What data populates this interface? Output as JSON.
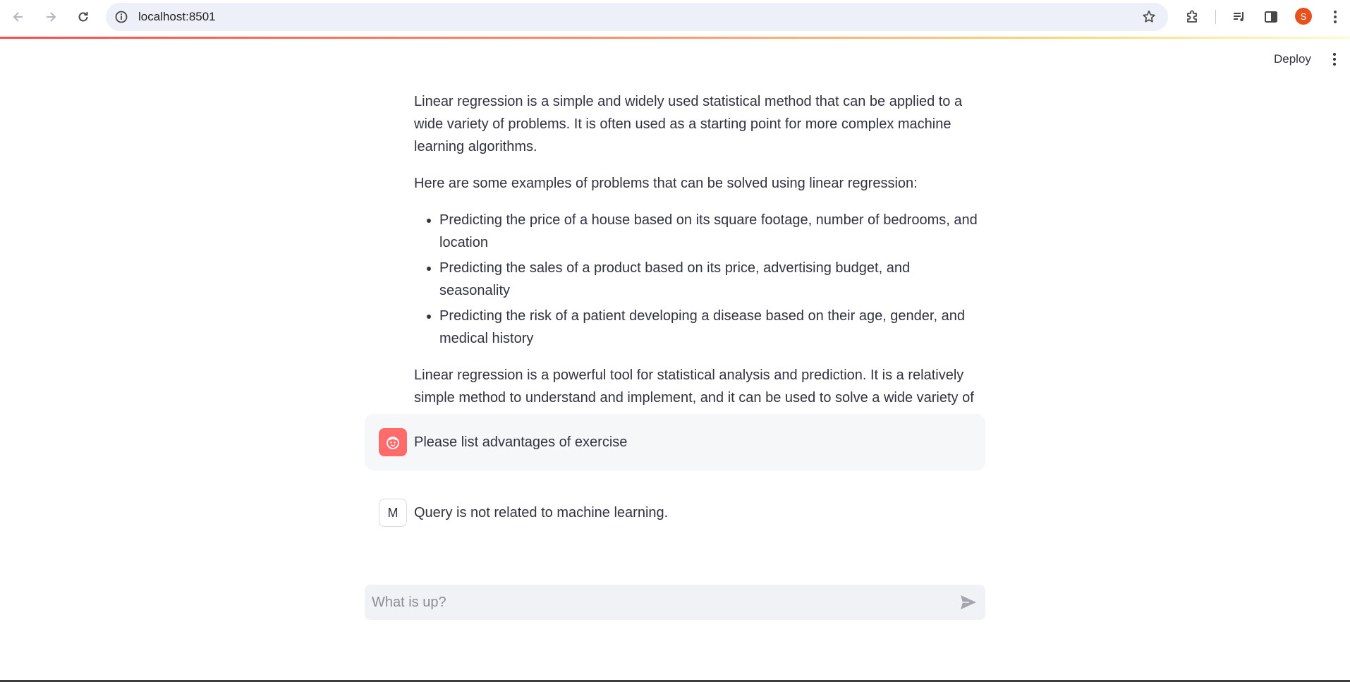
{
  "browser": {
    "url": "localhost:8501",
    "profile_initial": "S",
    "accent_color": "#e8501e"
  },
  "header": {
    "deploy_label": "Deploy"
  },
  "chat": {
    "assistant_response": {
      "para1": "Linear regression is a simple and widely used statistical method that can be applied to a wide variety of problems. It is often used as a starting point for more complex machine learning algorithms.",
      "para2": "Here are some examples of problems that can be solved using linear regression:",
      "bullets": [
        "Predicting the price of a house based on its square footage, number of bedrooms, and location",
        "Predicting the sales of a product based on its price, advertising budget, and seasonality",
        "Predicting the risk of a patient developing a disease based on their age, gender, and medical history"
      ],
      "para3": "Linear regression is a powerful tool for statistical analysis and prediction. It is a relatively simple method to understand and implement, and it can be used to solve a wide variety of problems."
    },
    "user_message": "Please list advantages of exercise",
    "assistant_avatar_letter": "M",
    "assistant_reply": "Query is not related to machine learning.",
    "input_placeholder": "What is up?"
  },
  "icons": {
    "back": "back-arrow-icon",
    "forward": "forward-arrow-icon",
    "reload": "reload-icon",
    "site_info": "info-icon",
    "bookmark": "star-icon",
    "extensions": "puzzle-icon",
    "media": "media-control-icon",
    "side_panel": "side-panel-icon",
    "browser_menu": "kebab-menu-icon",
    "app_menu": "kebab-menu-icon",
    "user_avatar": "face-icon",
    "send": "send-icon"
  },
  "colors": {
    "user_avatar_bg": "#ff6b6b",
    "user_msg_bg": "#f6f7f9",
    "input_bg": "#f0f2f6"
  }
}
